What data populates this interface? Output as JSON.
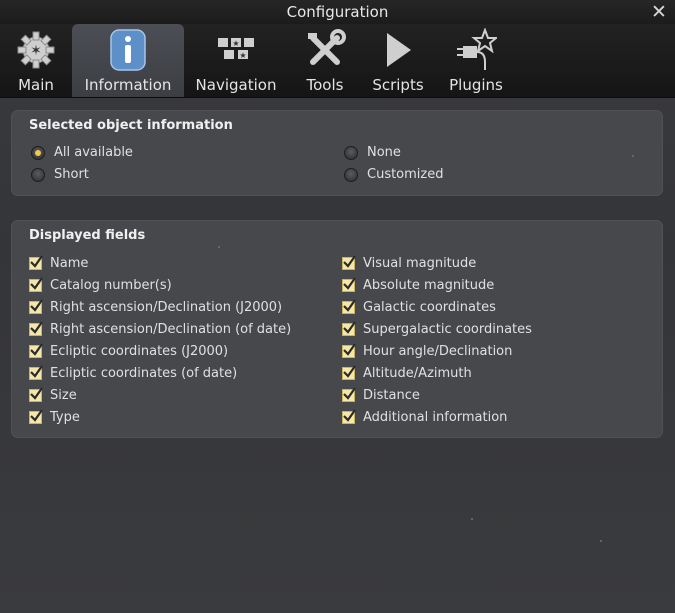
{
  "window": {
    "title": "Configuration",
    "close_glyph": "✕"
  },
  "tabs": [
    {
      "label": "Main",
      "icon": "gear-icon",
      "active": false
    },
    {
      "label": "Information",
      "icon": "info-icon",
      "active": true
    },
    {
      "label": "Navigation",
      "icon": "navigation-icon",
      "active": false
    },
    {
      "label": "Tools",
      "icon": "tools-icon",
      "active": false
    },
    {
      "label": "Scripts",
      "icon": "play-icon",
      "active": false
    },
    {
      "label": "Plugins",
      "icon": "plugin-icon",
      "active": false
    }
  ],
  "selected_info": {
    "title": "Selected object information",
    "options": [
      {
        "label": "All available",
        "selected": true
      },
      {
        "label": "Short",
        "selected": false
      },
      {
        "label": "None",
        "selected": false
      },
      {
        "label": "Customized",
        "selected": false
      }
    ]
  },
  "fields": {
    "title": "Displayed fields",
    "left": [
      "Name",
      "Catalog number(s)",
      "Right ascension/Declination (J2000)",
      "Right ascension/Declination (of date)",
      "Ecliptic coordinates (J2000)",
      "Ecliptic coordinates (of date)",
      "Size",
      "Type"
    ],
    "right": [
      "Visual magnitude",
      "Absolute magnitude",
      "Galactic coordinates",
      "Supergalactic coordinates",
      "Hour angle/Declination",
      "Altitude/Azimuth",
      "Distance",
      "Additional information"
    ]
  },
  "colors": {
    "accent": "#f2c94a",
    "check_fill": "#f4e7a8"
  }
}
